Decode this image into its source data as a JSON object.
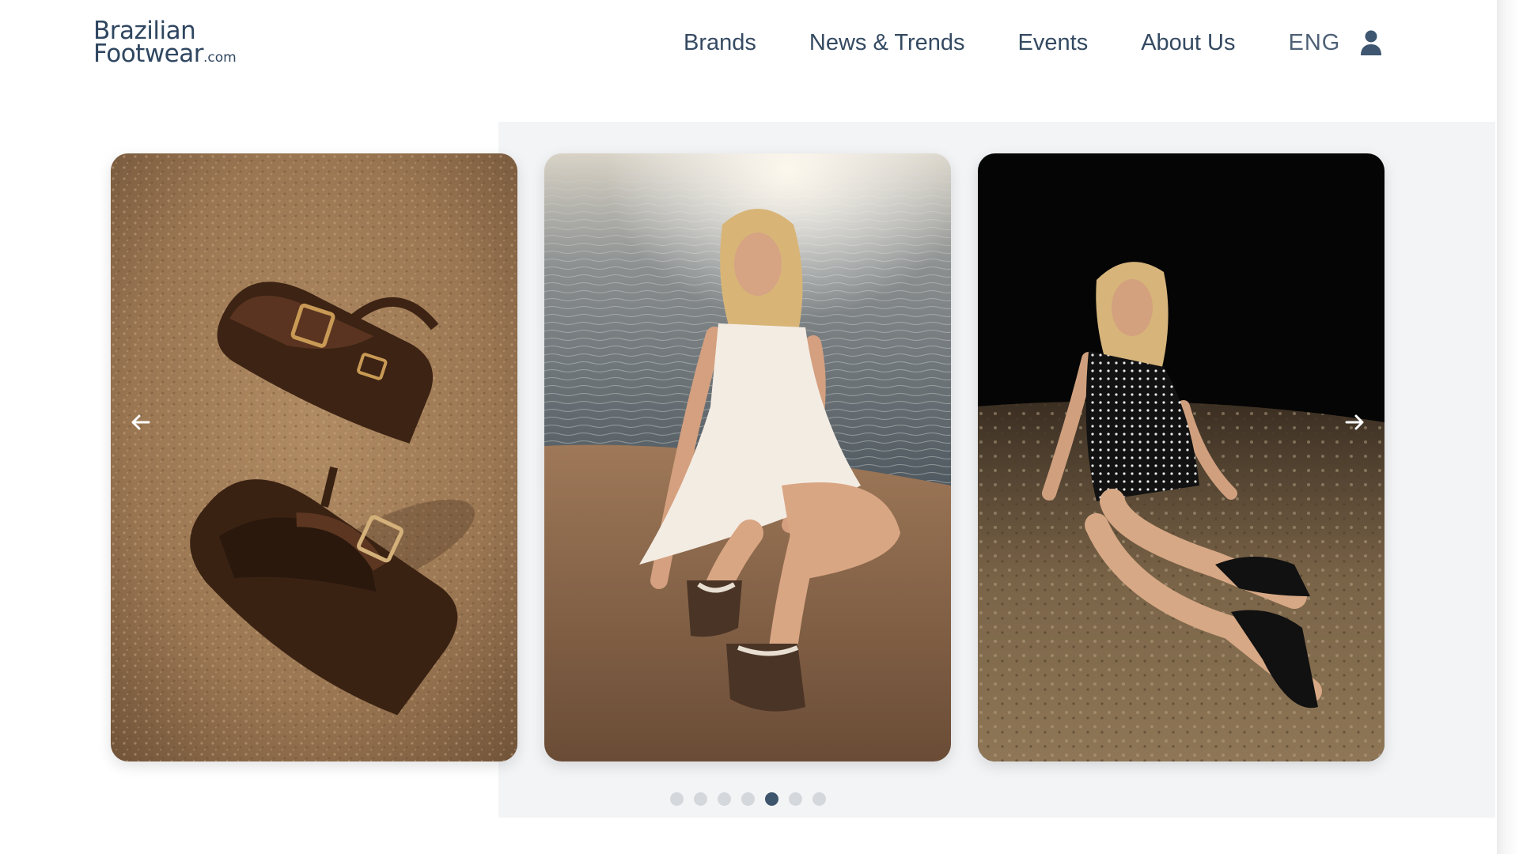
{
  "header": {
    "logo_line1": "Brazilian",
    "logo_line2": "Footwear",
    "logo_suffix": ".com",
    "nav": {
      "brands": "Brands",
      "news": "News & Trends",
      "events": "Events",
      "about": "About Us",
      "language": "ENG"
    }
  },
  "carousel": {
    "slides": [
      {
        "icon": "sandals-product-photo"
      },
      {
        "icon": "model-white-dress-photo"
      },
      {
        "icon": "model-black-dress-photo"
      }
    ],
    "prev_icon": "arrow-left-icon",
    "next_icon": "arrow-right-icon",
    "dot_count": 7,
    "active_dot_index": 4
  },
  "colors": {
    "brand": "#2f4660",
    "nav_text": "#354a62",
    "dot_active": "#3e556e",
    "dot_inactive": "#d4d7db"
  }
}
